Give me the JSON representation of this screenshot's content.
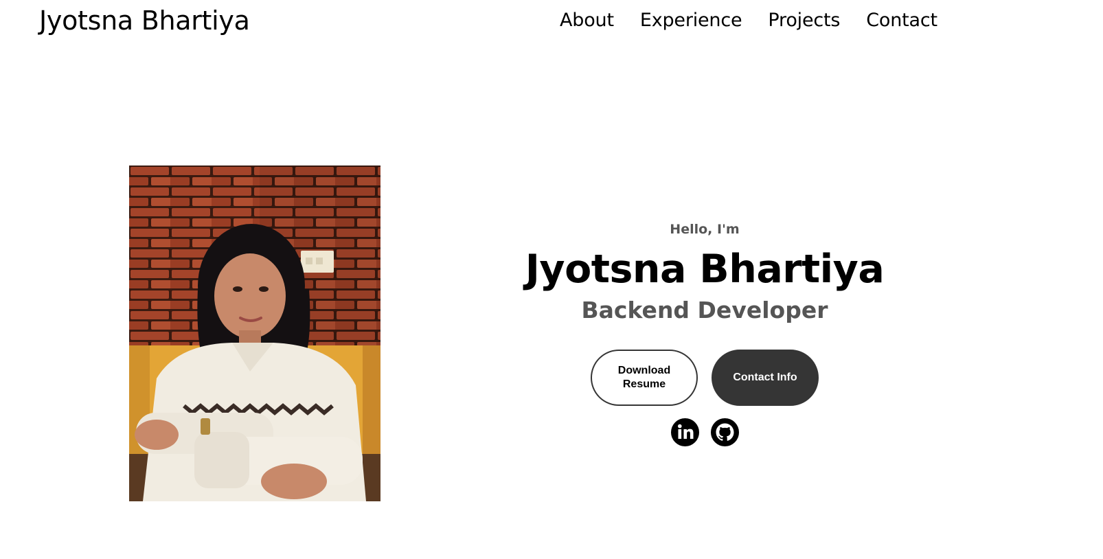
{
  "nav": {
    "logo": "Jyotsna Bhartiya",
    "links": [
      {
        "label": "About"
      },
      {
        "label": "Experience"
      },
      {
        "label": "Projects"
      },
      {
        "label": "Contact"
      }
    ]
  },
  "hero": {
    "greeting": "Hello, I'm",
    "name": "Jyotsna Bhartiya",
    "role": "Backend Developer",
    "buttons": {
      "resume": "Download Resume",
      "contact": "Contact Info"
    },
    "social": {
      "linkedin": "linkedin-icon",
      "github": "github-icon"
    }
  },
  "colors": {
    "text": "#000000",
    "muted": "#555555",
    "button_dark": "#353535",
    "background": "#ffffff"
  }
}
